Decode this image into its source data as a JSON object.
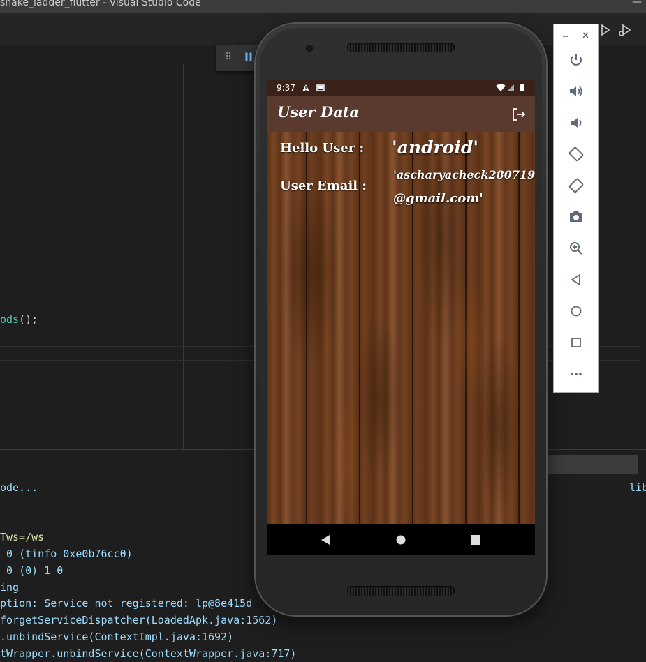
{
  "window": {
    "title": "snake_ladder_flutter - Visual Studio Code"
  },
  "editor": {
    "code_line": {
      "method": "ods",
      "rest": "();"
    }
  },
  "output_panel": {
    "lines": [
      {
        "text": "ode...",
        "color": "#9cdcfe"
      },
      {
        "text": "Tws=/ws",
        "color": "#dcdcaa"
      },
      {
        "text": " 0 (tinfo 0xe0b76cc0)",
        "color": "#9cdcfe"
      },
      {
        "text": " 0 (0) 1 0",
        "color": "#9cdcfe"
      },
      {
        "text": "ing",
        "color": "#9cdcfe"
      },
      {
        "text": "ption: Service not registered: lp@8e415d",
        "color": "#9cdcfe"
      },
      {
        "text": "forgetServiceDispatcher(LoadedApk.java:1562)",
        "color": "#9cdcfe"
      },
      {
        "text": ".unbindService(ContextImpl.java:1692)",
        "color": "#9cdcfe"
      },
      {
        "text": "tWrapper.unbindService(ContextWrapper.java:717)",
        "color": "#9cdcfe"
      }
    ],
    "link": "lib"
  },
  "phone": {
    "status_bar": {
      "time": "9:37"
    },
    "app_bar": {
      "title": "User Data",
      "action_icon": "logout-icon"
    },
    "content": {
      "hello_label": "Hello User :",
      "hello_value": "'android'",
      "email_label": "User Email :",
      "email_value_line1": "'ascharyacheck28071999",
      "email_value_line2": "@gmail.com'"
    },
    "nav_bar": {
      "buttons": [
        "back-icon",
        "home-icon",
        "recents-icon"
      ]
    }
  },
  "emulator_toolbar": {
    "window_controls": [
      "minimize-icon",
      "close-icon"
    ],
    "buttons": [
      "power-icon",
      "volume-up-icon",
      "volume-down-icon",
      "rotate-left-icon",
      "rotate-right-icon",
      "camera-icon",
      "zoom-icon",
      "back-icon",
      "home-icon",
      "overview-icon",
      "more-icon"
    ]
  },
  "colors": {
    "editor_bg": "#1e1e1e",
    "app_bar": "#5a3a2e",
    "status_bar": "#3b2218",
    "wood": "#6e3e1f"
  }
}
